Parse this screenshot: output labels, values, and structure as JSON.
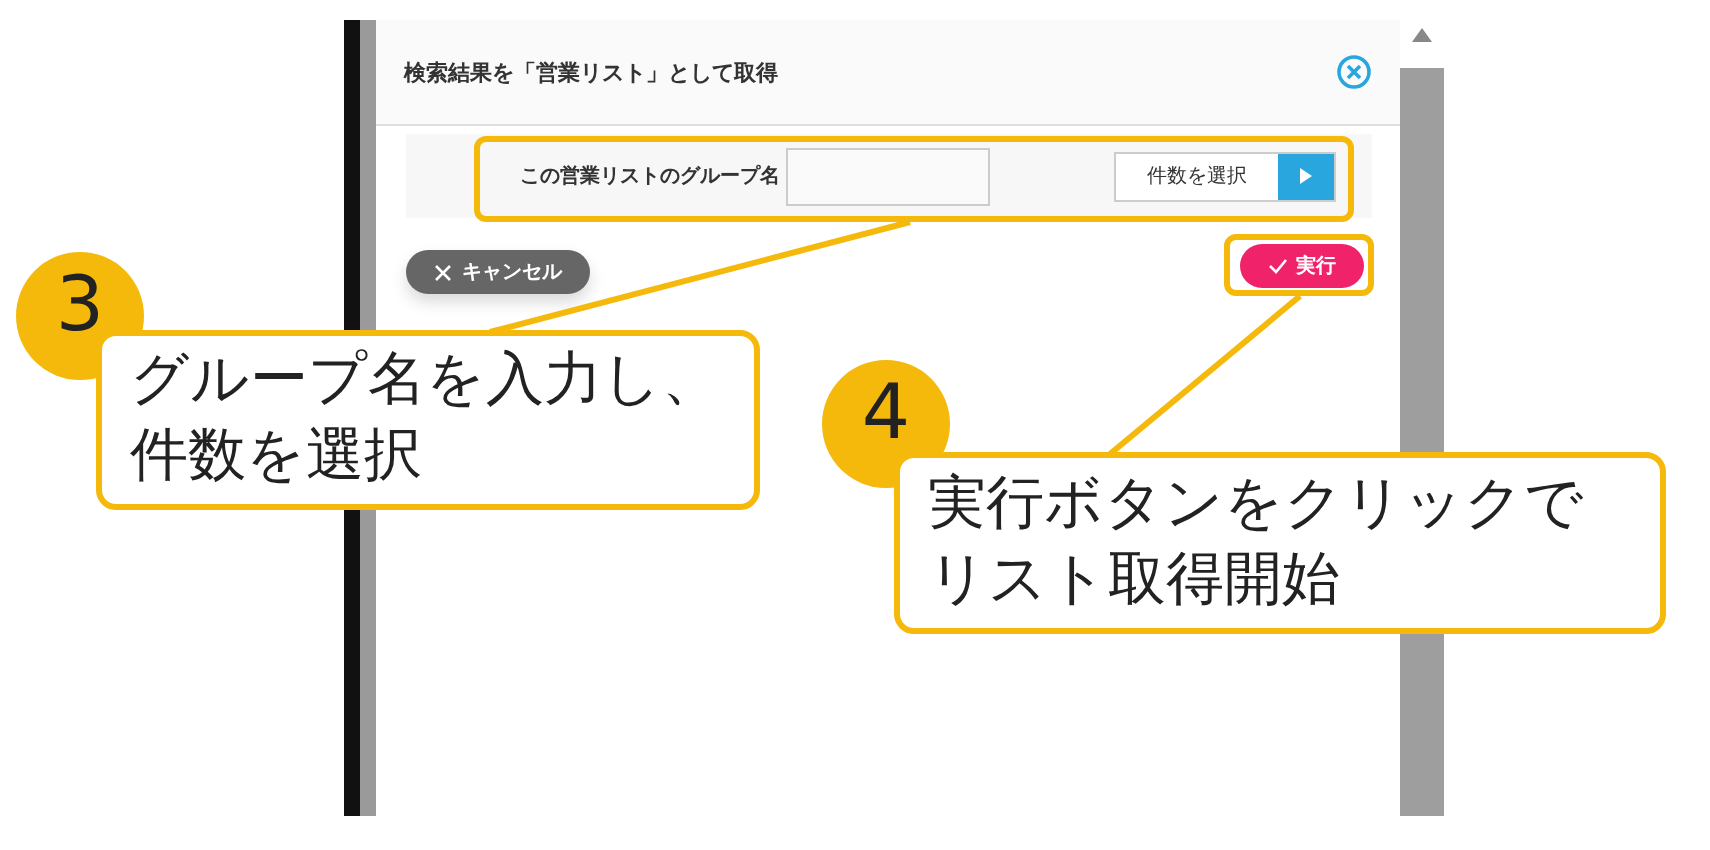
{
  "dialog": {
    "title": "検索結果を「営業リスト」として取得",
    "group_name_label": "この営業リストのグループ名",
    "count_select": "件数を選択",
    "cancel_button": "キャンセル",
    "run_button": "実行"
  },
  "callouts": [
    {
      "number": "3",
      "lines": [
        "グループ名を入力し、",
        "件数を選択"
      ]
    },
    {
      "number": "4",
      "lines": [
        "実行ボタンをクリックで",
        "リスト取得開始"
      ]
    }
  ]
}
